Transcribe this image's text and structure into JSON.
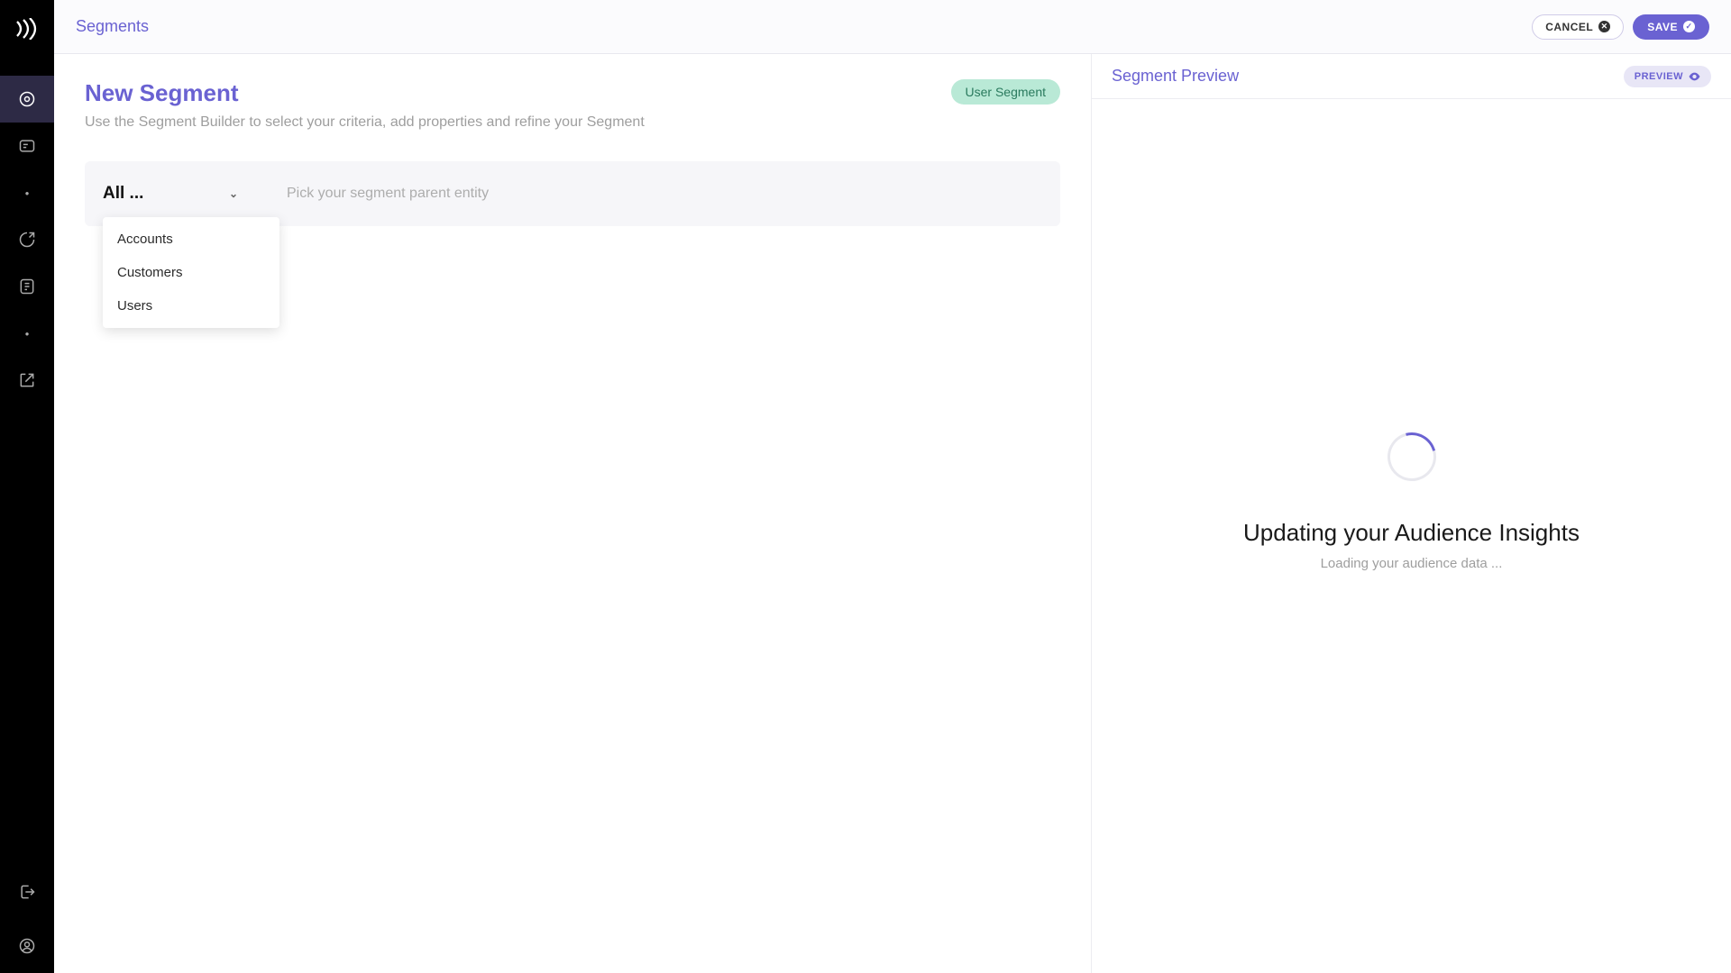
{
  "topbar": {
    "crumb": "Segments",
    "cancel_label": "CANCEL",
    "save_label": "SAVE"
  },
  "editor": {
    "title": "New Segment",
    "subtitle": "Use the Segment Builder to select your criteria, add properties and refine your Segment",
    "chip": "User Segment",
    "entity_selected": "All ...",
    "entity_hint": "Pick your segment parent entity",
    "entity_options": [
      "Accounts",
      "Customers",
      "Users"
    ]
  },
  "preview": {
    "header": "Segment Preview",
    "button": "PREVIEW",
    "loading_title": "Updating your Audience Insights",
    "loading_sub": "Loading your audience data ..."
  }
}
